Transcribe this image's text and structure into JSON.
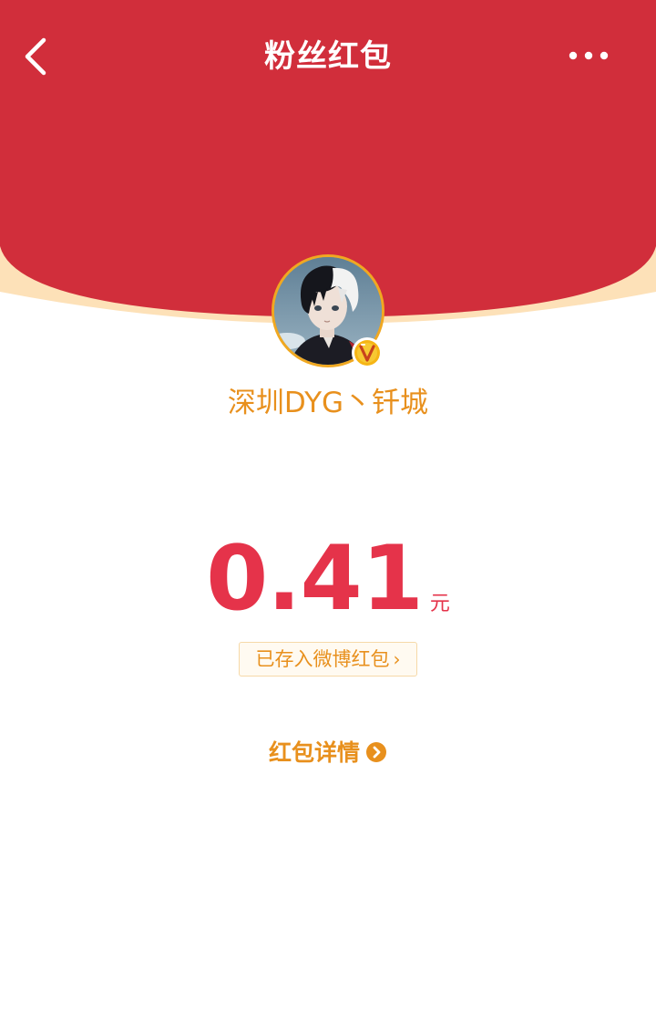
{
  "nav": {
    "title": "粉丝红包",
    "back_icon": "chevron-left-icon",
    "more_icon": "more-dots-icon"
  },
  "sender": {
    "name": "深圳DYG丶钎城",
    "avatar": "anime-boy-avatar",
    "badge_icon": "verified-v-badge-icon"
  },
  "amount": {
    "value": "0.41",
    "unit": "元"
  },
  "saved_link": {
    "label": "已存入微博红包",
    "icon": "chevron-right-icon"
  },
  "details_link": {
    "label": "红包详情",
    "icon": "arrow-right-circle-icon"
  },
  "colors": {
    "header_red": "#d12e3b",
    "header_rim": "#fde1b8",
    "accent_orange": "#e8901d",
    "amount_red": "#e5334a"
  }
}
